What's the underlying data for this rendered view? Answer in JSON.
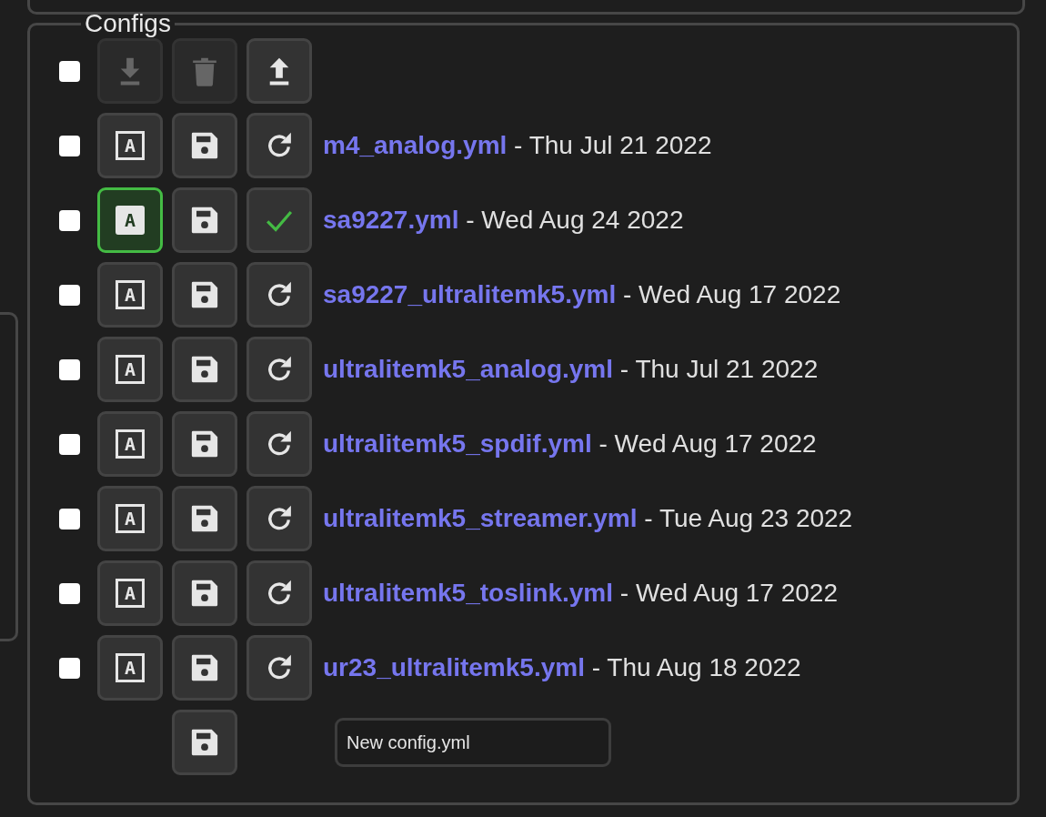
{
  "section": {
    "title": "Configs"
  },
  "toolbar": {
    "select_all_checked": false,
    "buttons": [
      {
        "kind": "download",
        "disabled": true
      },
      {
        "kind": "delete",
        "disabled": true
      },
      {
        "kind": "upload",
        "disabled": false
      }
    ]
  },
  "configs": [
    {
      "checked": false,
      "auto_label": "A",
      "active": false,
      "applied": false,
      "name": "m4_analog.yml",
      "date": " - Thu Jul 21 2022"
    },
    {
      "checked": false,
      "auto_label": "A",
      "active": true,
      "applied": true,
      "name": "sa9227.yml",
      "date": " - Wed Aug 24 2022"
    },
    {
      "checked": false,
      "auto_label": "A",
      "active": false,
      "applied": false,
      "name": "sa9227_ultralitemk5.yml",
      "date": " - Wed Aug 17 2022"
    },
    {
      "checked": false,
      "auto_label": "A",
      "active": false,
      "applied": false,
      "name": "ultralitemk5_analog.yml",
      "date": " - Thu Jul 21 2022"
    },
    {
      "checked": false,
      "auto_label": "A",
      "active": false,
      "applied": false,
      "name": "ultralitemk5_spdif.yml",
      "date": " - Wed Aug 17 2022"
    },
    {
      "checked": false,
      "auto_label": "A",
      "active": false,
      "applied": false,
      "name": "ultralitemk5_streamer.yml",
      "date": " - Tue Aug 23 2022"
    },
    {
      "checked": false,
      "auto_label": "A",
      "active": false,
      "applied": false,
      "name": "ultralitemk5_toslink.yml",
      "date": " - Wed Aug 17 2022"
    },
    {
      "checked": false,
      "auto_label": "A",
      "active": false,
      "applied": false,
      "name": "ur23_ultralitemk5.yml",
      "date": " - Thu Aug 18 2022"
    }
  ],
  "new_config": {
    "value": "New config.yml"
  }
}
